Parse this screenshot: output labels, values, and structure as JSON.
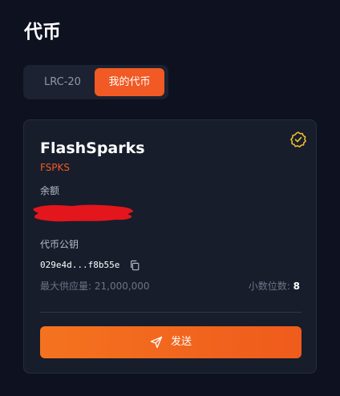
{
  "page": {
    "title": "代币"
  },
  "tabs": [
    {
      "label": "LRC-20",
      "active": false
    },
    {
      "label": "我的代币",
      "active": true
    }
  ],
  "token": {
    "name": "FlashSparks",
    "symbol": "FSPKS",
    "balance_label": "余额",
    "public_key_label": "代币公钥",
    "public_key": "029e4d...f8b55e",
    "max_supply_text": "最大供应量: 21,000,000",
    "decimals_label": "小数位数:",
    "decimals_value": "8",
    "send_label": "发送",
    "verified_icon": "verified-badge-icon"
  },
  "colors": {
    "background": "#0d1120",
    "card": "#171d2b",
    "accent": "#f15a24",
    "verified": "#f2c12e",
    "redaction": "#e3161d"
  }
}
